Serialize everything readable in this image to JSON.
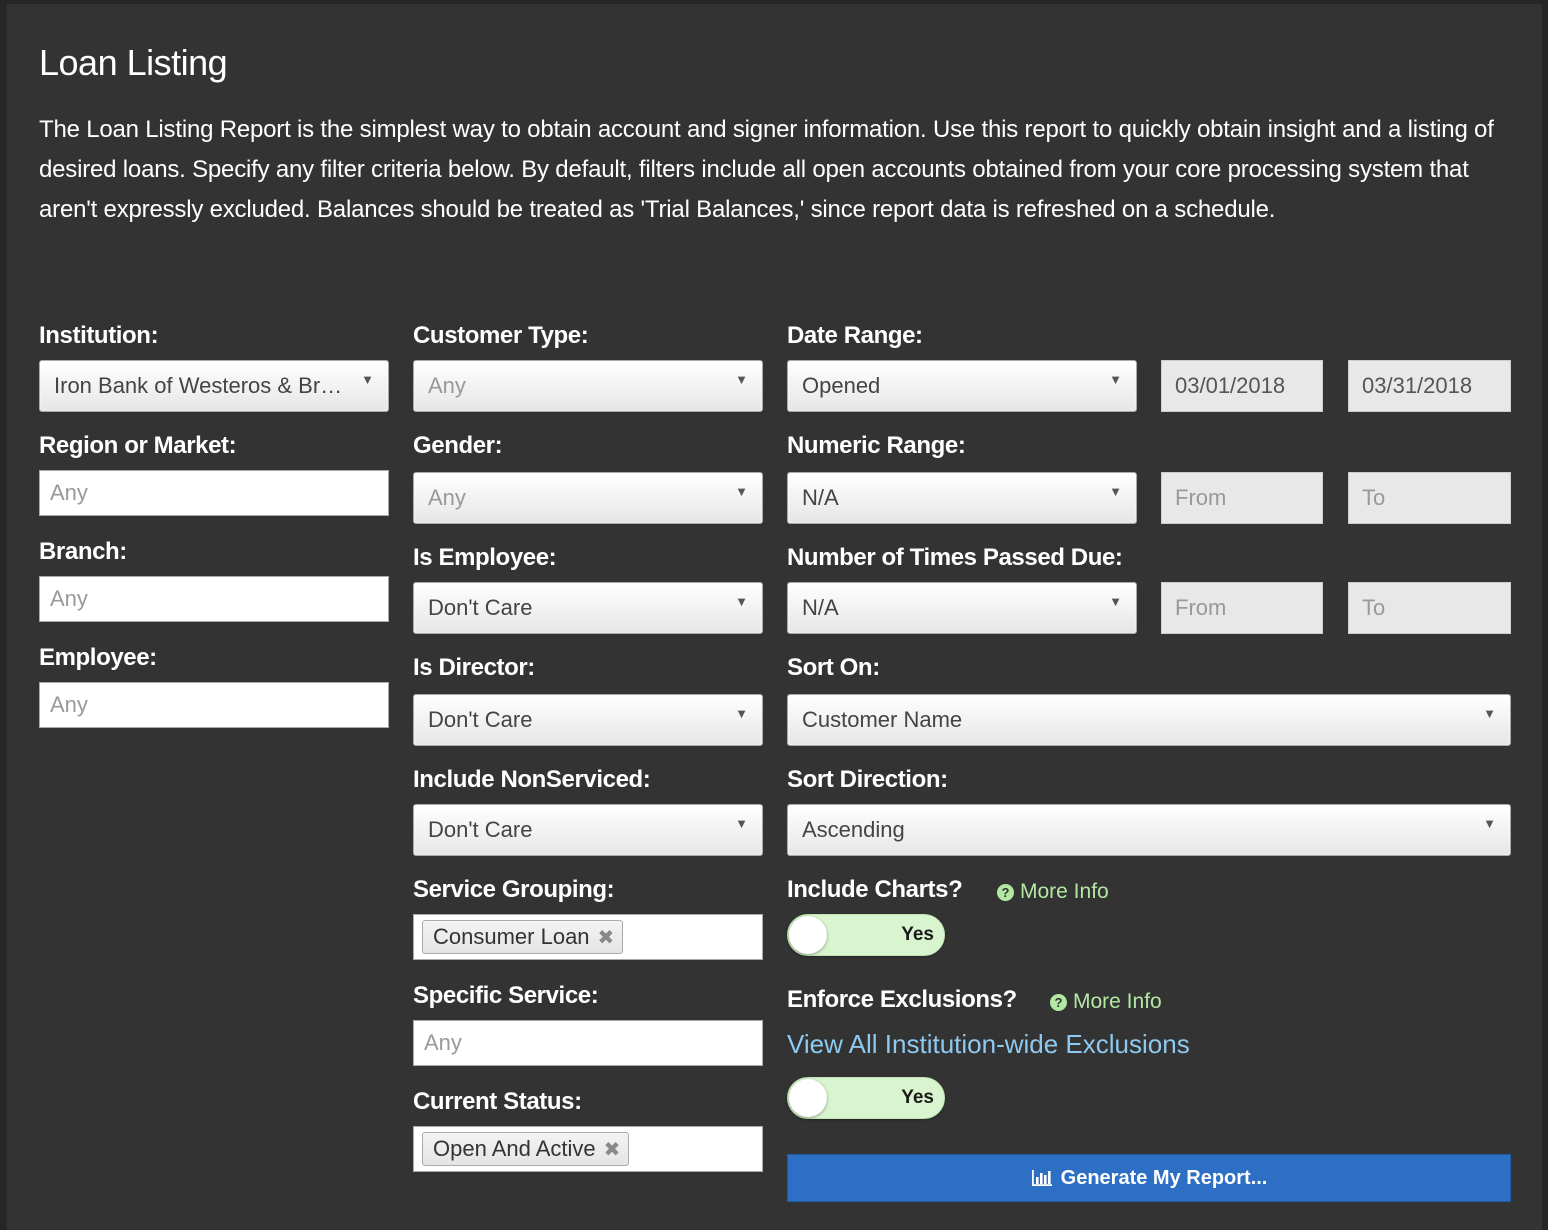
{
  "page": {
    "title": "Loan Listing",
    "description": "The Loan Listing Report is the simplest way to obtain account and signer information. Use this report to quickly obtain insight and a listing of desired loans. Specify any filter criteria below. By default, filters include all open accounts obtained from your core processing system that aren't expressly excluded. Balances should be treated as 'Trial Balances,' since report data is refreshed on a schedule."
  },
  "col1": {
    "institution": {
      "label": "Institution:",
      "value": "Iron Bank of Westeros & Braavos"
    },
    "region": {
      "label": "Region or Market:",
      "placeholder": "Any"
    },
    "branch": {
      "label": "Branch:",
      "placeholder": "Any"
    },
    "employee": {
      "label": "Employee:",
      "placeholder": "Any"
    }
  },
  "col2": {
    "customer_type": {
      "label": "Customer Type:",
      "value": "Any"
    },
    "gender": {
      "label": "Gender:",
      "value": "Any"
    },
    "is_employee": {
      "label": "Is Employee:",
      "value": "Don't Care"
    },
    "is_director": {
      "label": "Is Director:",
      "value": "Don't Care"
    },
    "include_nonserviced": {
      "label": "Include NonServiced:",
      "value": "Don't Care"
    },
    "service_grouping": {
      "label": "Service Grouping:",
      "tag": "Consumer Loan"
    },
    "specific_service": {
      "label": "Specific Service:",
      "placeholder": "Any"
    },
    "current_status": {
      "label": "Current Status:",
      "tag": "Open And Active"
    }
  },
  "col3": {
    "date_range": {
      "label": "Date Range:",
      "value": "Opened",
      "from": "03/01/2018",
      "to": "03/31/2018"
    },
    "numeric_range": {
      "label": "Numeric Range:",
      "value": "N/A",
      "from_placeholder": "From",
      "to_placeholder": "To"
    },
    "times_past_due": {
      "label": "Number of Times Passed Due:",
      "value": "N/A",
      "from_placeholder": "From",
      "to_placeholder": "To"
    },
    "sort_on": {
      "label": "Sort On:",
      "value": "Customer Name"
    },
    "sort_direction": {
      "label": "Sort Direction:",
      "value": "Ascending"
    },
    "include_charts": {
      "label": "Include Charts?",
      "more_info": "More Info",
      "toggle": "Yes"
    },
    "enforce_exclusions": {
      "label": "Enforce Exclusions?",
      "more_info": "More Info",
      "link": "View All Institution-wide Exclusions",
      "toggle": "Yes"
    },
    "generate_button": "Generate My Report..."
  },
  "icons": {
    "dropdown": "▼",
    "remove": "✖",
    "help": "?"
  },
  "colors": {
    "background": "#333333",
    "accent_button": "#2c6fc4",
    "more_info": "#b3e8a3",
    "link": "#8ec9f0",
    "toggle_on": "#d9f5cf"
  }
}
